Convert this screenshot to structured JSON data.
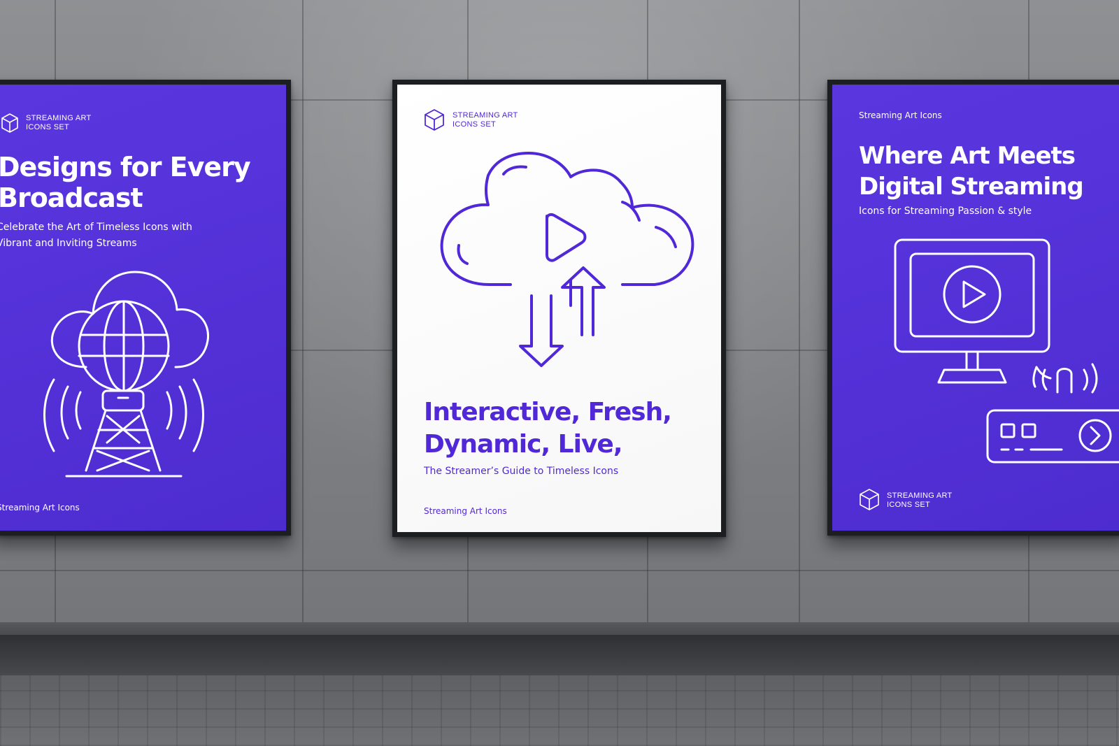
{
  "colors": {
    "brand_purple": "#5230d6",
    "poster_white": "#ffffff",
    "wall_gray": "#818386"
  },
  "posters": {
    "left": {
      "brand_line1": "STREAMING ART",
      "brand_line2": "ICONS SET",
      "headline_line1": "Designs for Every",
      "headline_line2": "Broadcast",
      "sub_line1": "Celebrate the Art of Timeless Icons with",
      "sub_line2": "Vibrant and Inviting Streams",
      "footer": "Streaming Art Icons",
      "icon": "cloud-globe-broadcast-tower-icon"
    },
    "center": {
      "brand_line1": "STREAMING ART",
      "brand_line2": "ICONS SET",
      "headline_line1": "Interactive, Fresh,",
      "headline_line2": "Dynamic, Live,",
      "subtitle": "The Streamer’s Guide to Timeless Icons",
      "footer": "Streaming Art Icons",
      "icon": "cloud-play-upload-download-icon"
    },
    "right": {
      "top_label": "Streaming Art Icons",
      "headline_line1": "Where Art Meets",
      "headline_line2": "Digital Streaming",
      "subtitle": "Icons for Streaming Passion & style",
      "brand_line1": "STREAMING ART",
      "brand_line2": "ICONS SET",
      "icon": "monitor-play-router-icon"
    }
  }
}
